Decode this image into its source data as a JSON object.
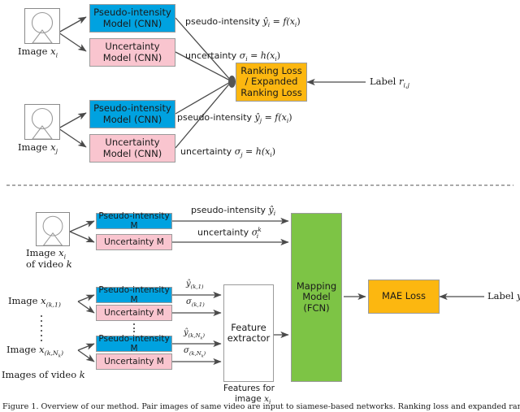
{
  "figure": {
    "caption": "Figure 1. Overview of our method. Pair images of same video are input to siamese-based networks. Ranking loss and expanded ranking"
  },
  "colors": {
    "blue": "#00a2e0",
    "pink": "#f9c5cf",
    "orange": "#fcb710",
    "green": "#7dc445",
    "white": "#ffffff",
    "stroke": "#4a4a4a"
  },
  "top_section": {
    "image_i": {
      "label_line1": "Image",
      "label_math": "x",
      "label_sub": "i"
    },
    "image_j": {
      "label_line1": "Image",
      "label_math": "x",
      "label_sub": "j"
    },
    "boxes": [
      {
        "id": "pseudo-intensity-model-i",
        "text": "Pseudo-intensity\nModel (CNN)",
        "color": "blue"
      },
      {
        "id": "uncertainty-model-i",
        "text": "Uncertainty\nModel (CNN)",
        "color": "pink"
      },
      {
        "id": "pseudo-intensity-model-j",
        "text": "Pseudo-intensity\nModel (CNN)",
        "color": "blue"
      },
      {
        "id": "uncertainty-model-j",
        "text": "Uncertainty\nModel (CNN)",
        "color": "pink"
      }
    ],
    "edge_labels": {
      "pseudo_i_text": "pseudo-intensity",
      "pseudo_i_math": "ŷ",
      "pseudo_i_sub": "i",
      "pseudo_i_eq": " = f(x",
      "pseudo_i_eq_sub": "i",
      "pseudo_i_eq_end": ")",
      "uncert_i_text": "uncertainty",
      "uncert_i_math": "σ",
      "uncert_i_sub": "i",
      "uncert_i_eq": " = h(x",
      "uncert_i_eq_sub": "i",
      "uncert_i_eq_end": ")",
      "pseudo_j_text": "pseudo-intensity",
      "pseudo_j_math": "ŷ",
      "pseudo_j_sub": "j",
      "pseudo_j_eq": " = f(x",
      "pseudo_j_eq_sub": "i",
      "pseudo_j_eq_end": ")",
      "uncert_j_text": "uncertainty",
      "uncert_j_math": "σ",
      "uncert_j_sub": "j",
      "uncert_j_eq": " = h(x",
      "uncert_j_eq_sub": "i",
      "uncert_j_eq_end": ")"
    },
    "loss_box": {
      "text": "Ranking Loss\n/ Expanded\nRanking Loss",
      "color": "orange"
    },
    "label_input": {
      "text": "Label",
      "math": "r",
      "sub": "i,j"
    }
  },
  "bottom_section": {
    "image_i": {
      "line1_text": "Image",
      "line1_math": "x",
      "line1_sub": "i",
      "line2_text": "of video",
      "line2_math": "k"
    },
    "image_k1": {
      "text": "Image",
      "math": "x",
      "sub": "(k,1)"
    },
    "image_kNk": {
      "text": "Image",
      "math": "x",
      "sub": "(k,N",
      "sub2": "k",
      "sub3": ")"
    },
    "images_of_video": {
      "text": "Images of video",
      "math": "k"
    },
    "boxes": [
      {
        "id": "pseudo-intensity-m-i",
        "text": "Pseudo-intensity M",
        "color": "blue"
      },
      {
        "id": "uncertainty-m-i",
        "text": "Uncertainty M",
        "color": "pink"
      },
      {
        "id": "pseudo-intensity-m-k1",
        "text": "Pseudo-intensity M",
        "color": "blue"
      },
      {
        "id": "uncertainty-m-k1",
        "text": "Uncertainty M",
        "color": "pink"
      },
      {
        "id": "pseudo-intensity-m-kNk",
        "text": "Pseudo-intensity M",
        "color": "blue"
      },
      {
        "id": "uncertainty-m-kNk",
        "text": "Uncertainty M",
        "color": "pink"
      }
    ],
    "edge_labels": {
      "pseudo_top_text": "pseudo-intensity",
      "pseudo_top_math": "ŷ",
      "pseudo_top_sub": "i",
      "uncert_top_text": "uncertainty",
      "uncert_top_math": "σ",
      "uncert_top_sub": "i",
      "uncert_top_sup": "k",
      "yhat_k1": "ŷ",
      "yhat_k1_sub": "(k,1)",
      "sigma_k1": "σ",
      "sigma_k1_sub": "(k,1)",
      "yhat_kNk": "ŷ",
      "yhat_kNk_sub": "(k,N",
      "yhat_kNk_sub2": "k",
      "yhat_kNk_sub3": ")",
      "sigma_kNk": "σ",
      "sigma_kNk_sub": "(k,N",
      "sigma_kNk_sub2": "k",
      "sigma_kNk_sub3": ")"
    },
    "feature_extractor": {
      "text": "Feature\nextractor",
      "color": "white"
    },
    "feature_caption": {
      "line1": "Features for",
      "line2_text": "image",
      "line2_math": "x",
      "line2_sub": "i"
    },
    "mapping_model": {
      "text": "Mapping\nModel\n(FCN)",
      "color": "green"
    },
    "mae_loss": {
      "text": "MAE Loss",
      "color": "orange"
    },
    "label_input": {
      "text": "Label",
      "math": "y",
      "sub": "i"
    }
  }
}
